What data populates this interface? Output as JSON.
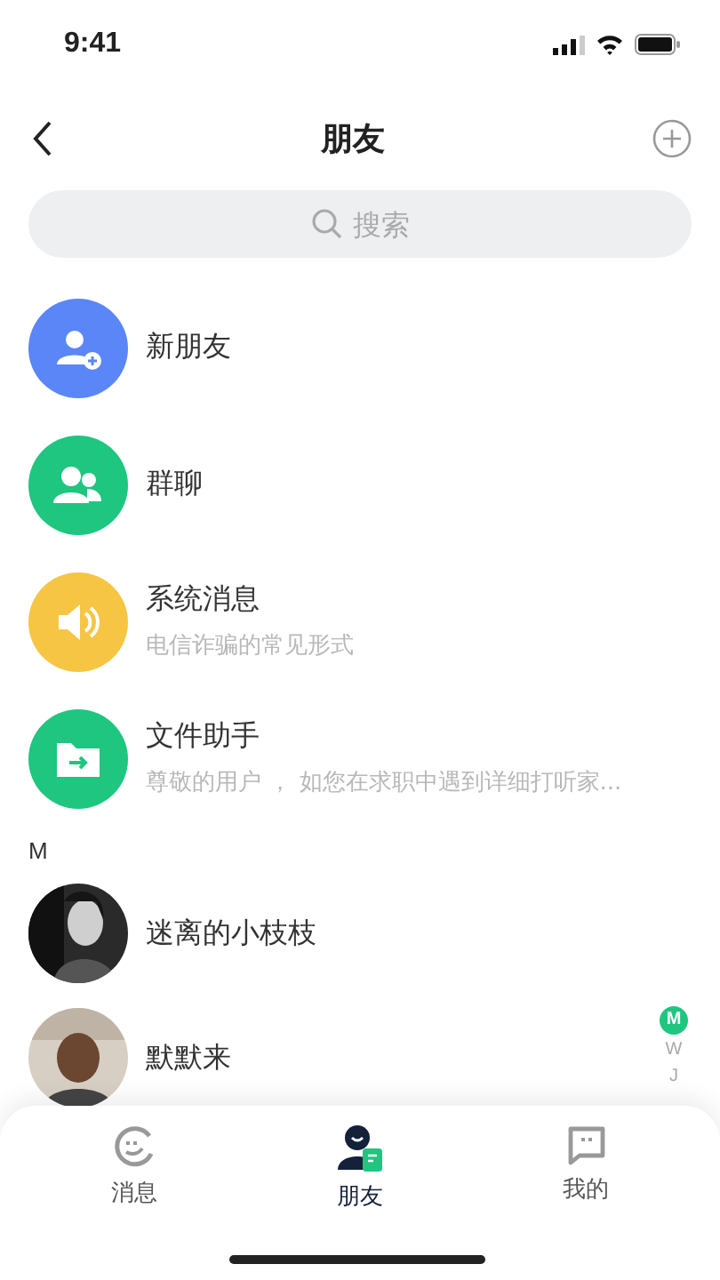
{
  "status_bar": {
    "time": "9:41"
  },
  "nav": {
    "title": "朋友"
  },
  "search": {
    "placeholder": "搜索"
  },
  "entries": [
    {
      "kind": "new-friend",
      "title": "新朋友",
      "color": "#5b86f7"
    },
    {
      "kind": "group",
      "title": "群聊",
      "color": "#1ec680"
    },
    {
      "kind": "system",
      "title": "系统消息",
      "subtitle": "电信诈骗的常见形式",
      "color": "#f6c544"
    },
    {
      "kind": "file",
      "title": "文件助手",
      "subtitle": "尊敬的用户 ， 如您在求职中遇到详细打听家...",
      "color": "#1ec680"
    }
  ],
  "section": "M",
  "contacts": [
    {
      "name": "迷离的小枝枝"
    },
    {
      "name": "默默来"
    }
  ],
  "index": [
    {
      "letter": "M",
      "selected": true
    },
    {
      "letter": "W",
      "selected": false
    },
    {
      "letter": "J",
      "selected": false
    }
  ],
  "tabs": [
    {
      "label": "消息",
      "selected": false
    },
    {
      "label": "朋友",
      "selected": true
    },
    {
      "label": "我的",
      "selected": false
    }
  ]
}
